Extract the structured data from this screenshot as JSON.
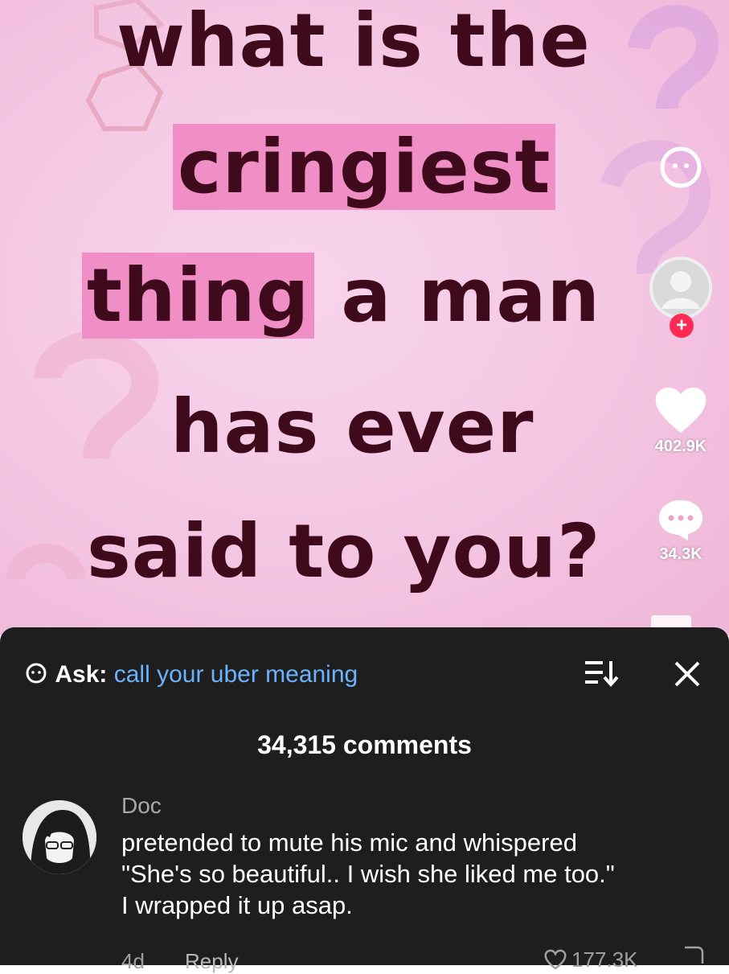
{
  "video": {
    "caption_lines": {
      "line1": "what is the",
      "line2_highlight": "cringiest",
      "line3_highlight": "thing",
      "line3_rest": "a man",
      "line4": "has ever",
      "line5": "said to you?"
    },
    "colors": {
      "background": "#f4c6e2",
      "highlight": "#ef8fc6",
      "text": "#3f0a1c"
    },
    "rail": {
      "follow_plus": "+",
      "likes": "402.9K",
      "comments": "34.3K"
    }
  },
  "comments_panel": {
    "ask_label": "Ask:",
    "ask_query": "call your uber meaning",
    "title": "34,315 comments",
    "comment": {
      "username": "Doc",
      "text_lines": [
        "pretended to mute his mic and whispered",
        "\"She's so beautiful.. I wish she liked me too.\"",
        "I wrapped it up asap."
      ],
      "age": "4d",
      "reply_label": "Reply",
      "likes": "177.3K"
    },
    "colors": {
      "panel": "#1e1e1e",
      "query": "#6ab3ff"
    }
  }
}
